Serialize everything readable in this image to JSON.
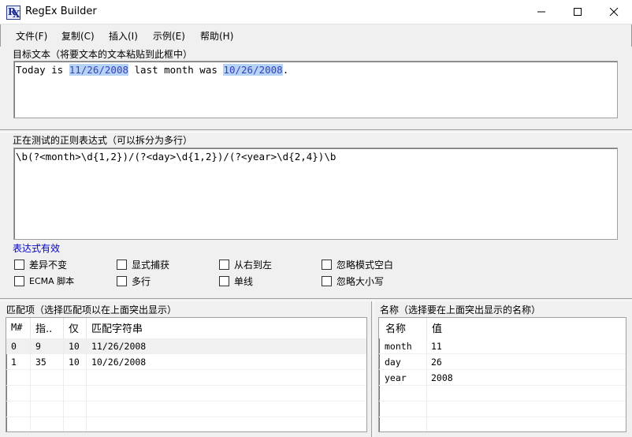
{
  "window": {
    "title": "RegEx Builder"
  },
  "menu": [
    "文件(F)",
    "复制(C)",
    "插入(I)",
    "示例(E)",
    "帮助(H)"
  ],
  "target_text": {
    "label": "目标文本（将要文本的文本粘贴到此框中）",
    "before": "Today is ",
    "match1": "11/26/2008",
    "middle": " last month was ",
    "match2": "10/26/2008",
    "after": "."
  },
  "regex": {
    "label": "正在测试的正则表达式（可以拆分为多行）",
    "value": "\\b(?<month>\\d{1,2})/(?<day>\\d{1,2})/(?<year>\\d{2,4})\\b",
    "status": "表达式有效",
    "status_color": "#0000cc"
  },
  "options": [
    "差异不变",
    "显式捕获",
    "从右到左",
    "忽略模式空白",
    "ECMA 脚本",
    "多行",
    "单线",
    "忽略大小写"
  ],
  "matches": {
    "label": "匹配项（选择匹配项以在上面突出显示）",
    "headers": [
      "M#",
      "指..",
      "仅",
      "匹配字符串"
    ],
    "rows": [
      [
        "0",
        "9",
        "10",
        "11/26/2008"
      ],
      [
        "1",
        "35",
        "10",
        "10/26/2008"
      ]
    ]
  },
  "names": {
    "label": "名称（选择要在上面突出显示的名称）",
    "headers": [
      "名称",
      "值"
    ],
    "rows": [
      [
        "month",
        "11"
      ],
      [
        "day",
        "26"
      ],
      [
        "year",
        "2008"
      ]
    ]
  }
}
